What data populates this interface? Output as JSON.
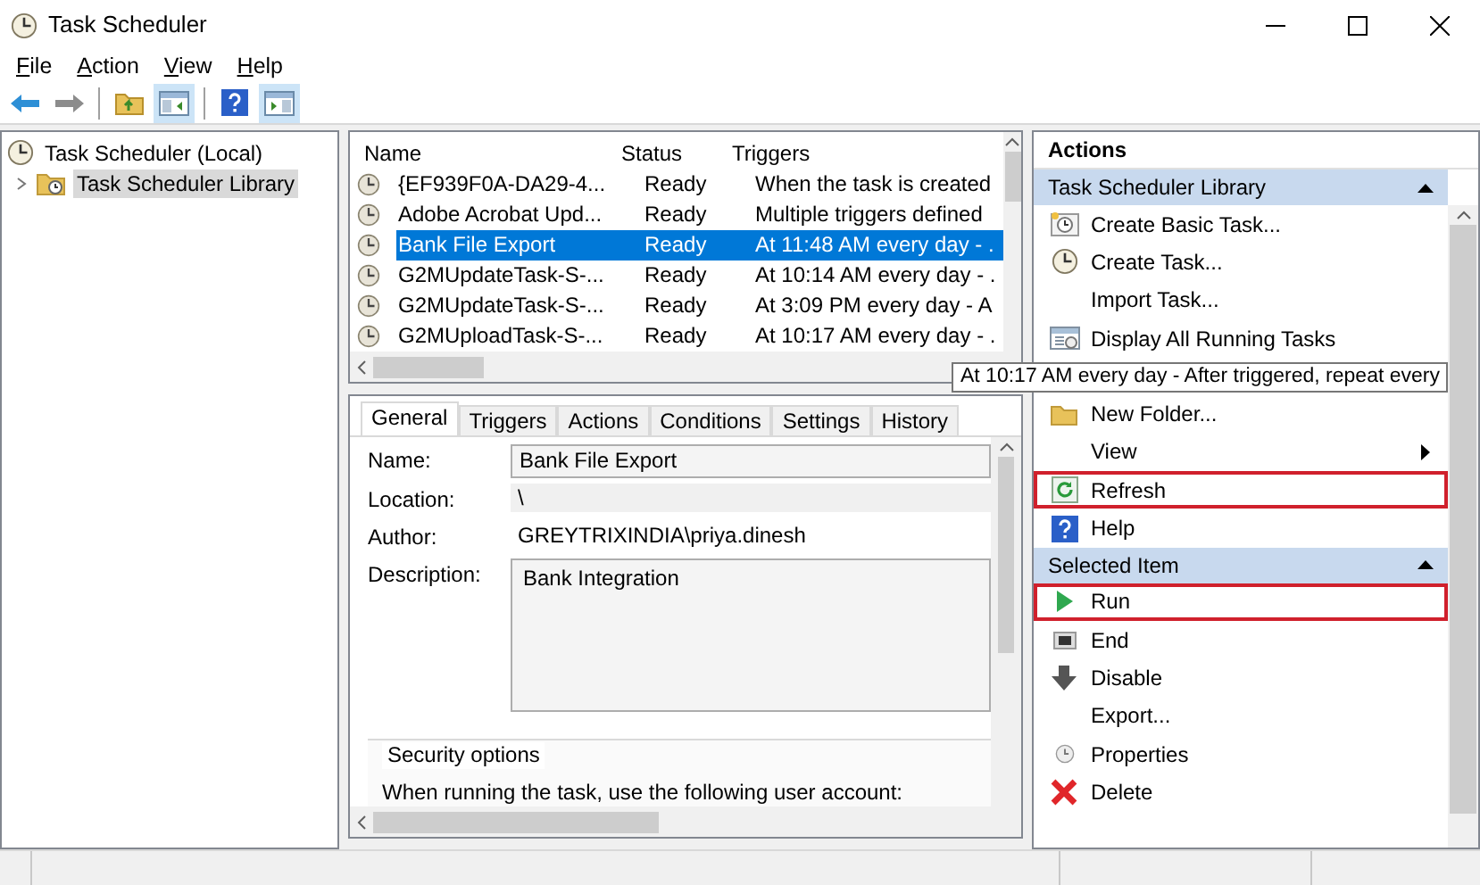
{
  "window": {
    "title": "Task Scheduler"
  },
  "menu": [
    {
      "label": "File"
    },
    {
      "label": "Action"
    },
    {
      "label": "View"
    },
    {
      "label": "Help"
    }
  ],
  "toolbar": [
    {
      "kind": "back",
      "pressed": false
    },
    {
      "kind": "forward",
      "pressed": false
    },
    {
      "kind": "separator"
    },
    {
      "kind": "folder-up",
      "pressed": false
    },
    {
      "kind": "pane-left",
      "pressed": true
    },
    {
      "kind": "separator"
    },
    {
      "kind": "help",
      "pressed": false
    },
    {
      "kind": "pane-right",
      "pressed": true
    }
  ],
  "tree": [
    {
      "label": "Task Scheduler (Local)",
      "selected": false,
      "children": [
        {
          "label": "Task Scheduler Library",
          "selected": true,
          "expanded": false
        }
      ]
    }
  ],
  "task_list": {
    "columns": [
      "Name",
      "Status",
      "Triggers"
    ],
    "rows": [
      {
        "name": "{EF939F0A-DA29-4...",
        "status": "Ready",
        "triggers": "When the task is created",
        "selected": false
      },
      {
        "name": "Adobe Acrobat Upd...",
        "status": "Ready",
        "triggers": "Multiple triggers defined",
        "selected": false
      },
      {
        "name": "Bank File Export",
        "status": "Ready",
        "triggers": "At 11:48 AM every day - .",
        "selected": true
      },
      {
        "name": "G2MUpdateTask-S-...",
        "status": "Ready",
        "triggers": "At 10:14 AM every day - .",
        "selected": false
      },
      {
        "name": "G2MUpdateTask-S-...",
        "status": "Ready",
        "triggers": "At 3:09 PM every day - A",
        "selected": false
      },
      {
        "name": "G2MUploadTask-S-...",
        "status": "Ready",
        "triggers": "At 10:17 AM every day - .",
        "selected": false
      }
    ]
  },
  "tooltip": "At 10:17 AM every day - After triggered, repeat every",
  "detail": {
    "tabs": [
      {
        "label": "General",
        "selected": true
      },
      {
        "label": "Triggers",
        "selected": false
      },
      {
        "label": "Actions",
        "selected": false
      },
      {
        "label": "Conditions",
        "selected": false
      },
      {
        "label": "Settings",
        "selected": false
      },
      {
        "label": "History",
        "selected": false
      }
    ],
    "fields": [
      {
        "label": "Name:",
        "value": "Bank File Export",
        "kind": "box"
      },
      {
        "label": "Location:",
        "value": "\\",
        "kind": "readonly"
      },
      {
        "label": "Author:",
        "value": "GREYTRIXINDIA\\priya.dinesh",
        "kind": "plain"
      },
      {
        "label": "Description:",
        "value": "Bank Integration",
        "kind": "area"
      }
    ],
    "security": {
      "legend": "Security options",
      "text": "When running the task, use the following user account:"
    }
  },
  "actions": {
    "title": "Actions",
    "groups": [
      {
        "title": "Task Scheduler Library",
        "expanded": true,
        "items": [
          {
            "label": "Create Basic Task...",
            "kind": "basic-task",
            "outlined": false,
            "submenu": false
          },
          {
            "label": "Create Task...",
            "kind": "clock",
            "outlined": false,
            "submenu": false
          },
          {
            "label": "Import Task...",
            "kind": "plain",
            "outlined": false,
            "submenu": false
          },
          {
            "label": "Display All Running Tasks",
            "kind": "running",
            "outlined": false,
            "submenu": false
          },
          {
            "kind": "covered"
          },
          {
            "label": "New Folder...",
            "kind": "folder",
            "outlined": false,
            "submenu": false
          },
          {
            "label": "View",
            "kind": "plain",
            "outlined": false,
            "submenu": true
          },
          {
            "label": "Refresh",
            "kind": "refresh",
            "outlined": true,
            "submenu": false
          },
          {
            "label": "Help",
            "kind": "help",
            "outlined": false,
            "submenu": false
          }
        ]
      },
      {
        "title": "Selected Item",
        "expanded": true,
        "items": [
          {
            "label": "Run",
            "kind": "run",
            "outlined": true,
            "submenu": false
          },
          {
            "label": "End",
            "kind": "end",
            "outlined": false,
            "submenu": false
          },
          {
            "label": "Disable",
            "kind": "disable",
            "outlined": false,
            "submenu": false
          },
          {
            "label": "Export...",
            "kind": "plain",
            "outlined": false,
            "submenu": false
          },
          {
            "label": "Properties",
            "kind": "clock-small",
            "outlined": false,
            "submenu": false
          },
          {
            "label": "Delete",
            "kind": "delete",
            "outlined": false,
            "submenu": false
          }
        ]
      }
    ]
  }
}
